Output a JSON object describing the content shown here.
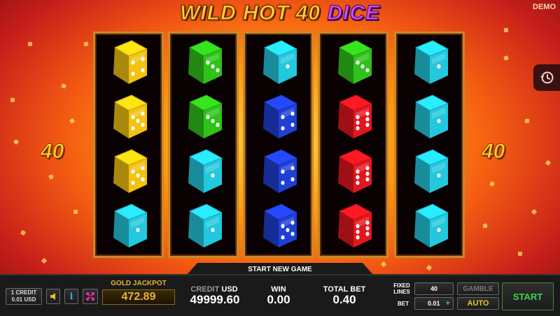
{
  "title": {
    "part1": "WILD HOT 40",
    "part2": "DICE"
  },
  "mode_badge": "DEMO",
  "paylines_left": "40",
  "paylines_right": "40",
  "colors": {
    "yellow": "#f3c20f",
    "green": "#2fc21a",
    "cyan": "#23c8de",
    "blue": "#1f3fd6",
    "red": "#e3161e"
  },
  "reels": [
    [
      {
        "color": "yellow",
        "pips": 4
      },
      {
        "color": "yellow",
        "pips": 5
      },
      {
        "color": "yellow",
        "pips": 5
      },
      {
        "color": "cyan",
        "pips": 1
      }
    ],
    [
      {
        "color": "green",
        "pips": 3
      },
      {
        "color": "green",
        "pips": 3
      },
      {
        "color": "cyan",
        "pips": 1
      },
      {
        "color": "cyan",
        "pips": 1
      }
    ],
    [
      {
        "color": "cyan",
        "pips": 1
      },
      {
        "color": "blue",
        "pips": 4
      },
      {
        "color": "blue",
        "pips": 4
      },
      {
        "color": "blue",
        "pips": 5
      }
    ],
    [
      {
        "color": "green",
        "pips": 3
      },
      {
        "color": "red",
        "pips": 6
      },
      {
        "color": "red",
        "pips": 6
      },
      {
        "color": "red",
        "pips": 6
      }
    ],
    [
      {
        "color": "cyan",
        "pips": 1
      },
      {
        "color": "cyan",
        "pips": 1
      },
      {
        "color": "cyan",
        "pips": 1
      },
      {
        "color": "cyan",
        "pips": 1
      }
    ]
  ],
  "bottom": {
    "start_new_game": "START NEW GAME",
    "denomination": {
      "line1": "1 CREDIT",
      "line2": "0.01 USD"
    },
    "gold_jackpot_label": "GOLD JACKPOT",
    "gold_jackpot_value": "472.89",
    "credit_label": "CREDIT",
    "credit_unit": "USD",
    "credit_value": "49999.60",
    "win_label": "WIN",
    "win_value": "0.00",
    "total_bet_label": "TOTAL BET",
    "total_bet_value": "0.40",
    "fixed_lines_label": "FIXED LINES",
    "fixed_lines_value": "40",
    "bet_label": "BET",
    "bet_value": "0.01",
    "bet_plus": "+",
    "gamble_label": "GAMBLE",
    "auto_label": "AUTO",
    "start_label": "START"
  }
}
